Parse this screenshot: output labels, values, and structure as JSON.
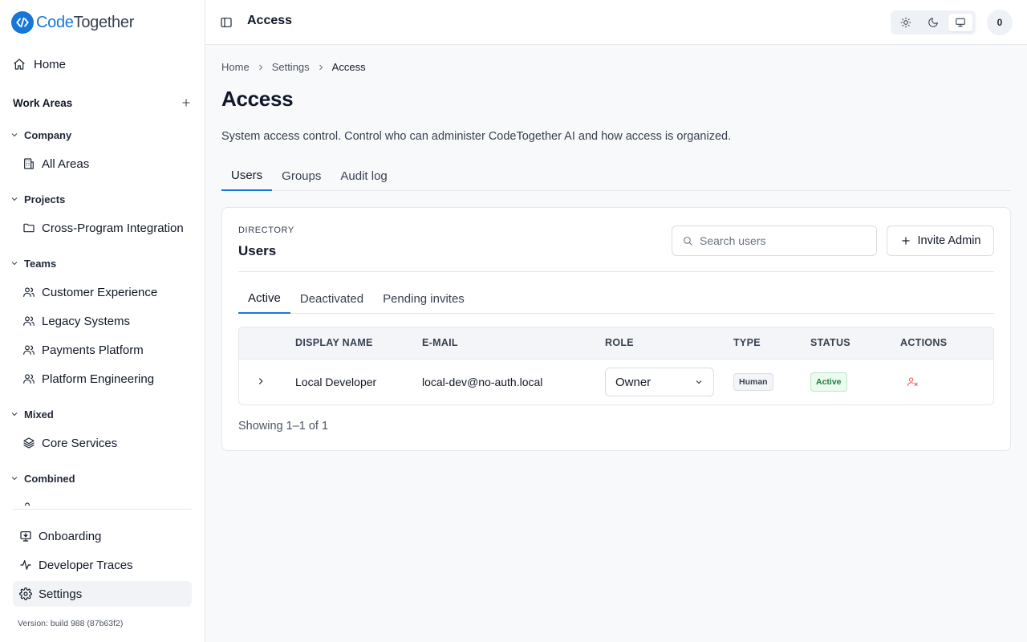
{
  "app": {
    "logo_part1": "Code",
    "logo_part2": "Together",
    "version": "Version: build 988 (87b63f2)"
  },
  "sidebar": {
    "home_label": "Home",
    "work_areas_label": "Work Areas",
    "groups": [
      {
        "label": "Company",
        "items": [
          {
            "label": "All Areas",
            "icon": "building-icon"
          }
        ]
      },
      {
        "label": "Projects",
        "items": [
          {
            "label": "Cross-Program Integration",
            "icon": "folder-icon"
          }
        ]
      },
      {
        "label": "Teams",
        "items": [
          {
            "label": "Customer Experience",
            "icon": "users-icon"
          },
          {
            "label": "Legacy Systems",
            "icon": "users-icon"
          },
          {
            "label": "Payments Platform",
            "icon": "users-icon"
          },
          {
            "label": "Platform Engineering",
            "icon": "users-icon"
          }
        ]
      },
      {
        "label": "Mixed",
        "items": [
          {
            "label": "Core Services",
            "icon": "layers-icon"
          }
        ]
      },
      {
        "label": "Combined",
        "items": []
      }
    ],
    "bottom": [
      {
        "label": "Onboarding",
        "icon": "monitor-download-icon"
      },
      {
        "label": "Developer Traces",
        "icon": "activity-icon"
      },
      {
        "label": "Settings",
        "icon": "gear-icon",
        "active": true
      }
    ]
  },
  "topbar": {
    "title": "Access",
    "theme_selected": "system",
    "avatar_initial": "0"
  },
  "breadcrumb": [
    "Home",
    "Settings",
    "Access"
  ],
  "page": {
    "title": "Access",
    "description": "System access control. Control who can administer CodeTogether AI and how access is organized.",
    "tabs": [
      "Users",
      "Groups",
      "Audit log"
    ],
    "active_tab": "Users"
  },
  "directory": {
    "eyebrow": "DIRECTORY",
    "title": "Users",
    "search_placeholder": "Search users",
    "invite_label": "Invite Admin",
    "subtabs": [
      "Active",
      "Deactivated",
      "Pending invites"
    ],
    "active_subtab": "Active",
    "columns": [
      "DISPLAY NAME",
      "E-MAIL",
      "ROLE",
      "TYPE",
      "STATUS",
      "ACTIONS"
    ],
    "rows": [
      {
        "display_name": "Local Developer",
        "email": "local-dev@no-auth.local",
        "role": "Owner",
        "type": "Human",
        "status": "Active"
      }
    ],
    "showing": "Showing 1–1 of 1"
  },
  "colors": {
    "accent": "#1677d9",
    "status_active_bg": "#ecfbef",
    "status_active_text": "#1e7a3b",
    "danger": "#e0575b"
  }
}
